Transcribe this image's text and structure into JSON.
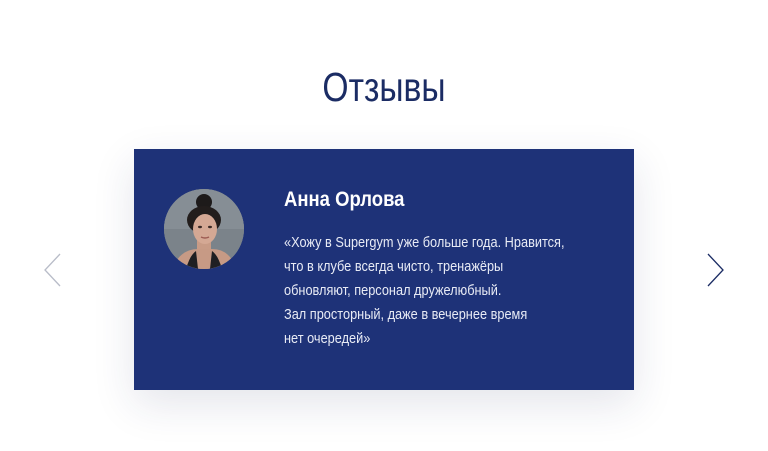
{
  "section": {
    "title": "Отзывы"
  },
  "testimonial": {
    "name": "Анна Орлова",
    "quote_lines": [
      "«Хожу в Supergym уже больше года. Нравится,",
      "что в клубе всегда чисто, тренажёры",
      "обновляют, персонал дружелюбный.",
      "Зал просторный, даже в вечернее время",
      "нет очередей»"
    ]
  },
  "navigation": {
    "prev_icon": "chevron-left-icon",
    "next_icon": "chevron-right-icon"
  },
  "colors": {
    "title": "#1b2c64",
    "card_background": "#1e3278",
    "card_text": "#ffffff",
    "arrow_prev": "#b8bcc8",
    "arrow_next": "#1b2c64"
  }
}
